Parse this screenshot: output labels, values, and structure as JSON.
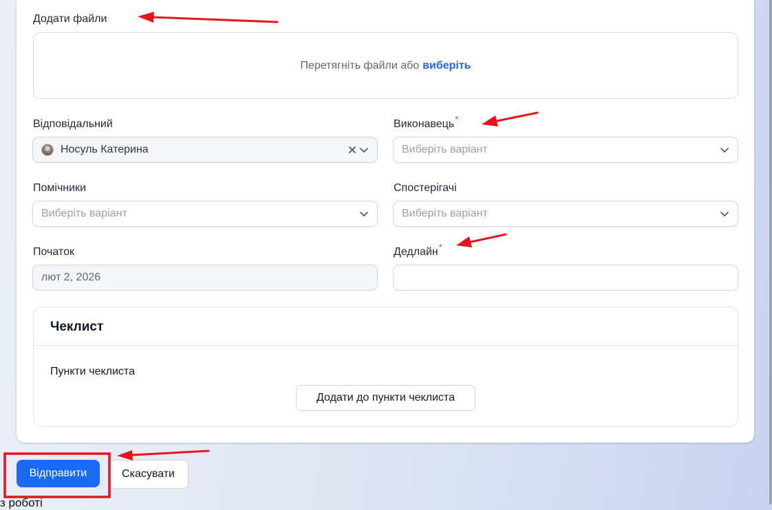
{
  "background": {
    "partial_text": "з роботі"
  },
  "attachments": {
    "label": "Додати файли",
    "drop_text": "Перетягніть файли або",
    "choose_link": "виберіть"
  },
  "responsible": {
    "label": "Відповідальний",
    "value": "Носуль Катерина"
  },
  "assignee": {
    "label": "Виконавець",
    "required_mark": "*",
    "placeholder": "Виберіть варіант"
  },
  "helpers": {
    "label": "Помічники",
    "placeholder": "Виберіть варіант"
  },
  "observers": {
    "label": "Спостерігачі",
    "placeholder": "Виберіть варіант"
  },
  "start": {
    "label": "Початок",
    "value": "лют 2, 2026"
  },
  "deadline": {
    "label": "Дедлайн",
    "required_mark": "*",
    "value": ""
  },
  "checklist": {
    "title": "Чеклист",
    "items_label": "Пункти чеклиста",
    "add_button": "Додати до пункти чеклиста"
  },
  "actions": {
    "submit": "Відправити",
    "cancel": "Скасувати"
  },
  "colors": {
    "primary": "#1a6af5",
    "link": "#2563eb",
    "required": "#e53935",
    "annotation": "#e8141c"
  },
  "icons": {
    "chevron": "chevron-down-icon",
    "clear": "close-icon",
    "avatar": "user-avatar"
  }
}
